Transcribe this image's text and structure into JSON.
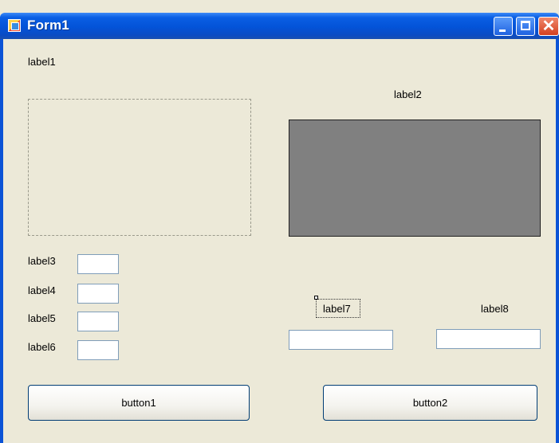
{
  "window": {
    "title": "Form1",
    "controls": {
      "minimize": "minimize",
      "maximize": "maximize",
      "close": "close"
    }
  },
  "labels": {
    "label1": "label1",
    "label2": "label2",
    "label3": "label3",
    "label4": "label4",
    "label5": "label5",
    "label6": "label6",
    "label7": "label7",
    "label8": "label8"
  },
  "inputs": {
    "textbox3": "",
    "textbox4": "",
    "textbox5": "",
    "textbox6": "",
    "textbox7": "",
    "textbox8": ""
  },
  "buttons": {
    "button1": "button1",
    "button2": "button2"
  },
  "icons": {
    "app": "form-app-icon",
    "minimize": "minimize-icon",
    "maximize": "maximize-icon",
    "close": "close-icon"
  },
  "colors": {
    "titlebar": "#0353d8",
    "form_background": "#ece9d8",
    "picturebox_fill": "#808080"
  }
}
